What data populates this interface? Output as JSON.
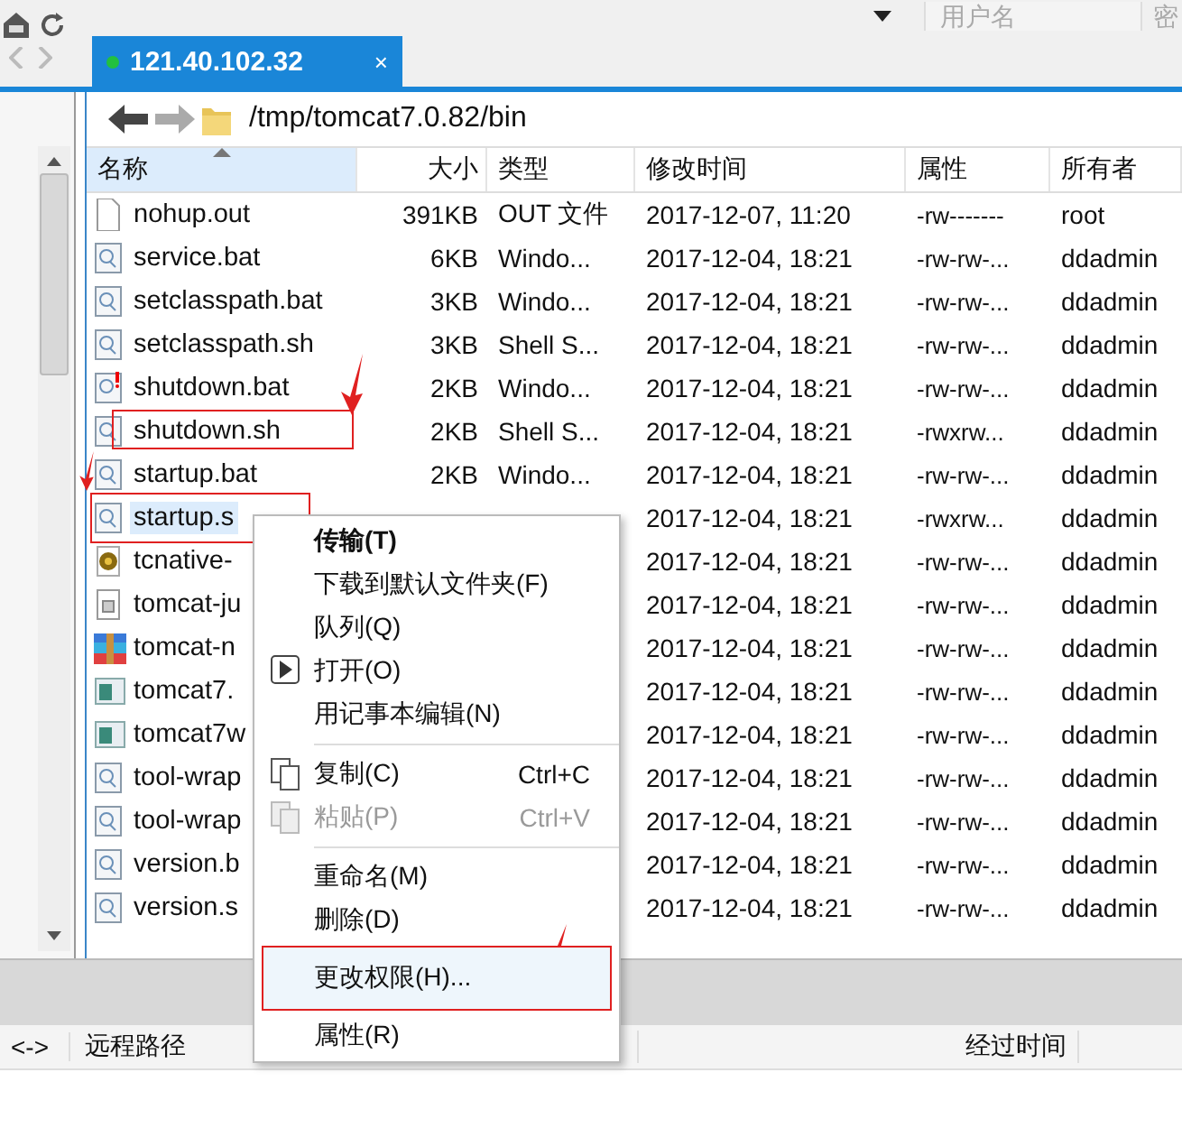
{
  "top_bar": {
    "fields": [
      {
        "placeholder": "用户名"
      },
      {
        "placeholder": "密"
      }
    ]
  },
  "tabs": [
    {
      "label": "121.40.102.32",
      "selected": true,
      "connected": true,
      "close": "×"
    }
  ],
  "path": "/tmp/tomcat7.0.82/bin",
  "columns": [
    "名称",
    "大小",
    "类型",
    "修改时间",
    "属性",
    "所有者"
  ],
  "rows": [
    {
      "kind": "doc",
      "name": "nohup.out",
      "size": "391KB",
      "type": "OUT 文件",
      "modified": "2017-12-07, 11:20",
      "attributes": "-rw-------",
      "owner": "root",
      "selected": false,
      "marked": false
    },
    {
      "kind": "script",
      "name": "service.bat",
      "size": "6KB",
      "type": "Windo...",
      "modified": "2017-12-04, 18:21",
      "attributes": "-rw-rw-...",
      "owner": "ddadmin",
      "selected": false,
      "marked": false
    },
    {
      "kind": "script",
      "name": "setclasspath.bat",
      "size": "3KB",
      "type": "Windo...",
      "modified": "2017-12-04, 18:21",
      "attributes": "-rw-rw-...",
      "owner": "ddadmin",
      "selected": false,
      "marked": false
    },
    {
      "kind": "script",
      "name": "setclasspath.sh",
      "size": "3KB",
      "type": "Shell S...",
      "modified": "2017-12-04, 18:21",
      "attributes": "-rw-rw-...",
      "owner": "ddadmin",
      "selected": false,
      "marked": false
    },
    {
      "kind": "warning",
      "name": "shutdown.bat",
      "size": "2KB",
      "type": "Windo...",
      "modified": "2017-12-04, 18:21",
      "attributes": "-rw-rw-...",
      "owner": "ddadmin",
      "selected": false,
      "marked": false
    },
    {
      "kind": "script",
      "name": "shutdown.sh",
      "size": "2KB",
      "type": "Shell S...",
      "modified": "2017-12-04, 18:21",
      "attributes": "-rwxrw...",
      "owner": "ddadmin",
      "selected": false,
      "marked": true
    },
    {
      "kind": "script",
      "name": "startup.bat",
      "size": "2KB",
      "type": "Windo...",
      "modified": "2017-12-04, 18:21",
      "attributes": "-rw-rw-...",
      "owner": "ddadmin",
      "selected": false,
      "marked": false
    },
    {
      "kind": "script",
      "name": "startup.s",
      "modified": "2017-12-04, 18:21",
      "attributes": "-rwxrw...",
      "owner": "ddadmin",
      "selected": true,
      "marked": true
    },
    {
      "kind": "gear",
      "name": "tcnative-",
      "modified": "2017-12-04, 18:21",
      "attributes": "-rw-rw-...",
      "owner": "ddadmin",
      "selected": false,
      "marked": false
    },
    {
      "kind": "jar",
      "name": "tomcat-ju",
      "modified": "2017-12-04, 18:21",
      "attributes": "-rw-rw-...",
      "owner": "ddadmin",
      "selected": false,
      "marked": false
    },
    {
      "kind": "archive",
      "name": "tomcat-n",
      "modified": "2017-12-04, 18:21",
      "attributes": "-rw-rw-...",
      "owner": "ddadmin",
      "selected": false,
      "marked": false
    },
    {
      "kind": "exe",
      "name": "tomcat7.",
      "modified": "2017-12-04, 18:21",
      "attributes": "-rw-rw-...",
      "owner": "ddadmin",
      "selected": false,
      "marked": false
    },
    {
      "kind": "exe",
      "name": "tomcat7w",
      "modified": "2017-12-04, 18:21",
      "attributes": "-rw-rw-...",
      "owner": "ddadmin",
      "selected": false,
      "marked": false
    },
    {
      "kind": "script",
      "name": "tool-wrap",
      "modified": "2017-12-04, 18:21",
      "attributes": "-rw-rw-...",
      "owner": "ddadmin",
      "selected": false,
      "marked": false
    },
    {
      "kind": "script",
      "name": "tool-wrap",
      "modified": "2017-12-04, 18:21",
      "attributes": "-rw-rw-...",
      "owner": "ddadmin",
      "selected": false,
      "marked": false
    },
    {
      "kind": "script",
      "name": "version.b",
      "modified": "2017-12-04, 18:21",
      "attributes": "-rw-rw-...",
      "owner": "ddadmin",
      "selected": false,
      "marked": false
    },
    {
      "kind": "script",
      "name": "version.s",
      "modified": "2017-12-04, 18:21",
      "attributes": "-rw-rw-...",
      "owner": "ddadmin",
      "selected": false,
      "marked": false
    }
  ],
  "context_menu": {
    "items": [
      {
        "kind": "item",
        "label": "传输(T)",
        "bold": true,
        "disabled": false,
        "hovered": false,
        "marked": false
      },
      {
        "kind": "item",
        "label": "下载到默认文件夹(F)",
        "bold": false,
        "disabled": false,
        "hovered": false,
        "marked": false
      },
      {
        "kind": "item",
        "label": "队列(Q)",
        "bold": false,
        "disabled": false,
        "hovered": false,
        "marked": false
      },
      {
        "kind": "play",
        "label": "打开(O)",
        "bold": false,
        "disabled": false,
        "hovered": false,
        "marked": false
      },
      {
        "kind": "item",
        "label": "用记事本编辑(N)",
        "bold": false,
        "disabled": false,
        "hovered": false,
        "marked": false
      },
      {
        "kind": "separator"
      },
      {
        "kind": "copy",
        "label": "复制(C)",
        "shortcut": "Ctrl+C",
        "bold": false,
        "disabled": false,
        "hovered": false,
        "marked": false
      },
      {
        "kind": "paste",
        "label": "粘贴(P)",
        "shortcut": "Ctrl+V",
        "bold": false,
        "disabled": true,
        "hovered": false,
        "marked": false
      },
      {
        "kind": "separator"
      },
      {
        "kind": "item",
        "label": "重命名(M)",
        "bold": false,
        "disabled": false,
        "hovered": false,
        "marked": false
      },
      {
        "kind": "item",
        "label": "删除(D)",
        "bold": false,
        "disabled": false,
        "hovered": false,
        "marked": false
      },
      {
        "kind": "item",
        "label": "更改权限(H)...",
        "bold": false,
        "disabled": false,
        "hovered": true,
        "marked": true
      },
      {
        "kind": "item",
        "label": "属性(R)",
        "bold": false,
        "disabled": false,
        "hovered": false,
        "marked": false
      }
    ]
  },
  "transfer_queue": {
    "columns": [
      "<->",
      "远程路径",
      "经过时间"
    ]
  }
}
